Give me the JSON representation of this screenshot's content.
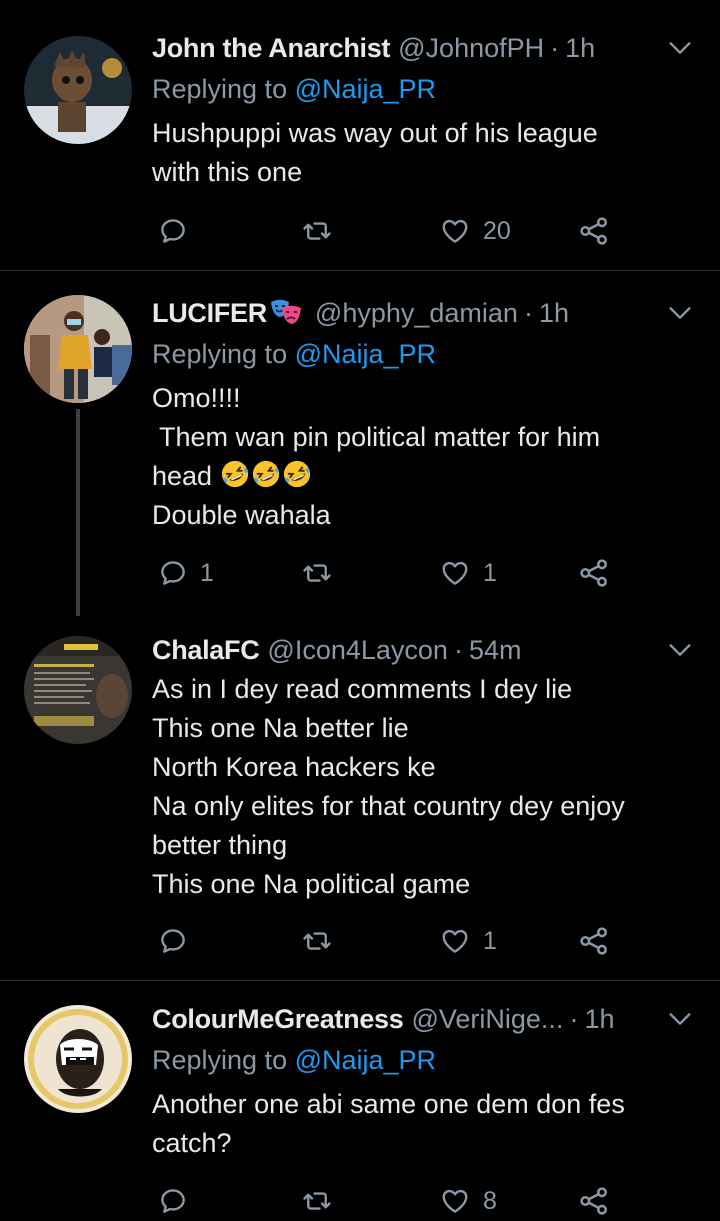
{
  "tweets": [
    {
      "name": "John the Anarchist",
      "handle": "@JohnofPH",
      "dot": "·",
      "time": "1h",
      "reply_prefix": "Replying to ",
      "reply_mention": "@Naija_PR",
      "lines": [
        "Hushpuppi was way out of his league",
        "with this one"
      ],
      "reply_count": "",
      "retweet_count": "",
      "like_count": "20"
    },
    {
      "name": "LUCIFER",
      "handle": "@hyphy_damian",
      "dot": "·",
      "time": "1h",
      "reply_prefix": "Replying to ",
      "reply_mention": "@Naija_PR",
      "lines": [
        "Omo!!!!",
        " Them wan pin political matter for him",
        "head",
        "Double wahala"
      ],
      "reply_count": "1",
      "retweet_count": "",
      "like_count": "1"
    },
    {
      "name": "ChalaFC",
      "handle": "@Icon4Laycon",
      "dot": "·",
      "time": "54m",
      "lines": [
        "As in I dey read comments I dey lie",
        "This one Na better lie",
        "North Korea hackers ke",
        "Na only elites for that country dey enjoy",
        "better thing",
        "This one Na political game"
      ],
      "reply_count": "",
      "retweet_count": "",
      "like_count": "1"
    },
    {
      "name": "ColourMeGreatness",
      "handle": "@VeriNige...",
      "dot": "·",
      "time": "1h",
      "reply_prefix": "Replying to ",
      "reply_mention": "@Naija_PR",
      "lines": [
        "Another one abi same one dem don fes",
        "catch?"
      ],
      "reply_count": "",
      "retweet_count": "",
      "like_count": "8"
    }
  ],
  "icons": {
    "name_badge": "performing-arts-icon",
    "emoji": "rolling-on-floor-laughing-emoji",
    "reply": "reply-icon",
    "retweet": "retweet-icon",
    "like": "heart-icon",
    "share": "share-icon",
    "menu": "chevron-down-icon"
  },
  "colors": {
    "background": "#000000",
    "text": "#e7e9ea",
    "secondary": "#8b98a5",
    "link": "#1d9bf0",
    "divider": "#2f3336"
  }
}
